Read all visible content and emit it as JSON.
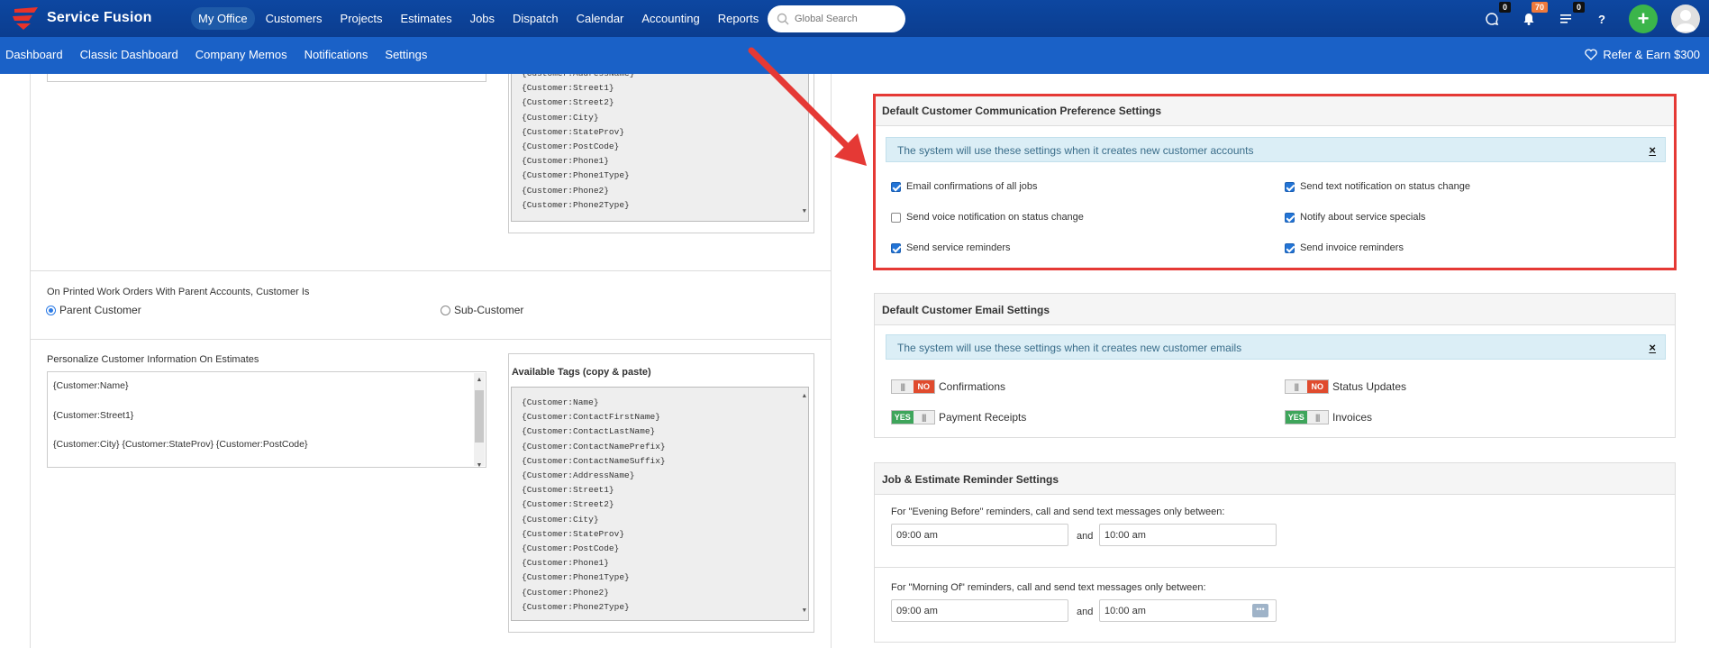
{
  "brand": {
    "name": "Service Fusion"
  },
  "nav": {
    "items": [
      "My Office",
      "Customers",
      "Projects",
      "Estimates",
      "Jobs",
      "Dispatch",
      "Calendar",
      "Accounting",
      "Reports"
    ],
    "active": "My Office"
  },
  "search": {
    "placeholder": "Global Search"
  },
  "header_icons": {
    "chat_badge": "0",
    "notifications_badge": "70",
    "tasks_badge": "0",
    "help_label": "?",
    "add_label": "+"
  },
  "subnav": {
    "items": [
      "Dashboard",
      "Classic Dashboard",
      "Company Memos",
      "Notifications",
      "Settings"
    ],
    "refer": "Refer & Earn $300"
  },
  "top_tags": [
    "{Customer:AddressName}",
    "{Customer:Street1}",
    "{Customer:Street2}",
    "{Customer:City}",
    "{Customer:StateProv}",
    "{Customer:PostCode}",
    "{Customer:Phone1}",
    "{Customer:Phone1Type}",
    "{Customer:Phone2}",
    "{Customer:Phone2Type}"
  ],
  "parent_accounts": {
    "label": "On Printed Work Orders With Parent Accounts, Customer Is",
    "option_parent": "Parent Customer",
    "option_sub": "Sub-Customer"
  },
  "estimates": {
    "label": "Personalize Customer Information On Estimates",
    "line1": "{Customer:Name}",
    "line2": "{Customer:Street1}",
    "line3": "{Customer:City} {Customer:StateProv} {Customer:PostCode}",
    "tags_title": "Available Tags (copy & paste)",
    "tags": [
      "{Customer:Name}",
      "{Customer:ContactFirstName}",
      "{Customer:ContactLastName}",
      "{Customer:ContactNamePrefix}",
      "{Customer:ContactNameSuffix}",
      "{Customer:AddressName}",
      "{Customer:Street1}",
      "{Customer:Street2}",
      "{Customer:City}",
      "{Customer:StateProv}",
      "{Customer:PostCode}",
      "{Customer:Phone1}",
      "{Customer:Phone1Type}",
      "{Customer:Phone2}",
      "{Customer:Phone2Type}"
    ]
  },
  "comm_prefs": {
    "title": "Default Customer Communication Preference Settings",
    "info": "The system will use these settings when it creates new customer accounts",
    "close": "×",
    "options": [
      {
        "label": "Email confirmations of all jobs",
        "checked": true
      },
      {
        "label": "Send text notification on status change",
        "checked": true
      },
      {
        "label": "Send voice notification on status change",
        "checked": false
      },
      {
        "label": "Notify about service specials",
        "checked": true
      },
      {
        "label": "Send service reminders",
        "checked": true
      },
      {
        "label": "Send invoice reminders",
        "checked": true
      }
    ]
  },
  "email_settings": {
    "title": "Default Customer Email Settings",
    "info": "The system will use these settings when it creates new customer emails",
    "close": "×",
    "toggles": [
      {
        "label": "Confirmations",
        "state": "NO"
      },
      {
        "label": "Status Updates",
        "state": "NO"
      },
      {
        "label": "Payment Receipts",
        "state": "YES"
      },
      {
        "label": "Invoices",
        "state": "YES"
      }
    ],
    "grip": "|||"
  },
  "reminders": {
    "title": "Job & Estimate Reminder Settings",
    "evening_label": "For \"Evening Before\" reminders, call and send text messages only between:",
    "evening_from": "09:00 am",
    "evening_to": "10:00 am",
    "morning_label": "For \"Morning Of\" reminders, call and send text messages only between:",
    "morning_from": "09:00 am",
    "morning_to": "10:00 am",
    "and": "and"
  },
  "colors": {
    "topbar": "#0b3d91",
    "subbar": "#1a61c7",
    "highlight": "#e53935",
    "toggle_no": "#e04b2e",
    "toggle_yes": "#3ea55b",
    "add_button": "#3bb54a"
  }
}
